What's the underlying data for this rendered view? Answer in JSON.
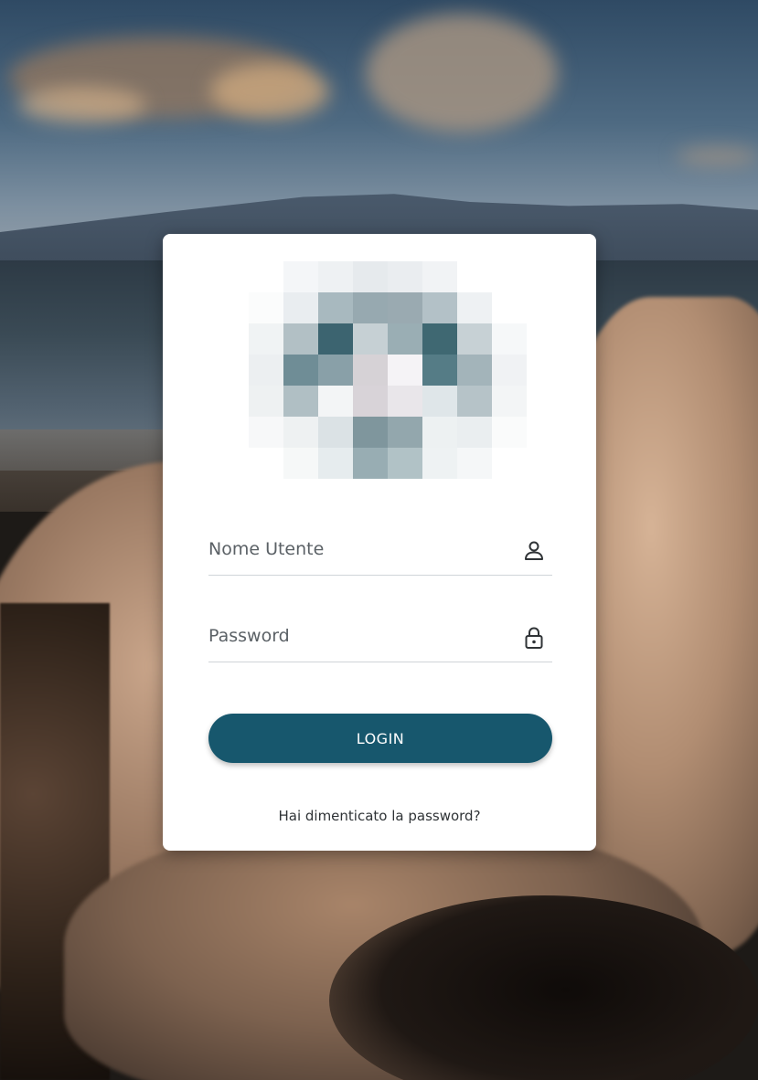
{
  "login_form": {
    "username_placeholder": "Nome Utente",
    "username_value": "",
    "password_placeholder": "Password",
    "password_value": "",
    "login_label": "LOGIN",
    "forgot_password_label": "Hai dimenticato la password?"
  },
  "icons": {
    "username": "user-icon",
    "password": "lock-icon"
  },
  "colors": {
    "accent": "#17576d",
    "card_background": "#ffffff",
    "text": "#2f3336"
  }
}
